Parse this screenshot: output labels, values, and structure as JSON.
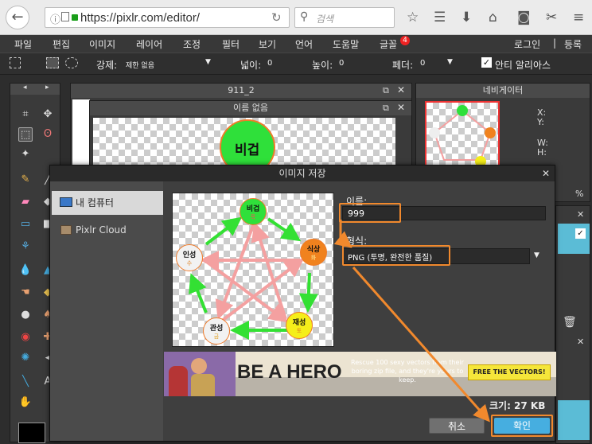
{
  "browser": {
    "url": "https://pixlr.com/editor/",
    "search_placeholder": "검색",
    "icons": [
      "back-icon",
      "info-icon",
      "page-icon",
      "lock-icon",
      "reload-icon",
      "search-icon",
      "star-icon",
      "reading-list-icon",
      "download-icon",
      "home-icon",
      "pocket-icon",
      "screenshot-icon",
      "menu-icon"
    ]
  },
  "menu": {
    "items": [
      "파일",
      "편집",
      "이미지",
      "레이어",
      "조정",
      "필터",
      "보기",
      "언어",
      "도움말",
      "글꼴"
    ],
    "badge": "4",
    "login": "로그인",
    "separator": "|",
    "register": "등록"
  },
  "options": {
    "force_label": "강제:",
    "force_value": "제한 없음",
    "width_label": "넓이:",
    "width_value": "0",
    "height_label": "높이:",
    "height_value": "0",
    "feather_label": "페더:",
    "feather_value": "0",
    "antialias_label": "안티 알리아스"
  },
  "panels": {
    "doc1_title": "911_2",
    "doc2_title": "이름 없음",
    "doc2_canvas_text": "비겁",
    "navigator_title": "네비게이터",
    "nav_x": "X:",
    "nav_y": "Y:",
    "nav_w": "W:",
    "nav_h": "H:",
    "zoom_unit": "%"
  },
  "dialog": {
    "title": "이미지 저장",
    "locations": [
      "내 컴퓨터",
      "Pixlr Cloud"
    ],
    "name_label": "이름:",
    "name_value": "999",
    "format_label": "형식:",
    "format_value": "PNG (투명, 완전한 품질)",
    "size_text": "크기: 27 KB",
    "cancel_label": "취소",
    "ok_label": "확인",
    "ad": {
      "headline": "BE A HERO",
      "body": "Rescue 100 sexy vectors from their boring zip file, and they're yours to keep.",
      "cta": "FREE THE VECTORS!"
    }
  },
  "preview": {
    "nodes": [
      {
        "label": "비겁",
        "sub": "목",
        "color": "#2fe03a"
      },
      {
        "label": "식상",
        "sub": "화",
        "color": "#f0821e"
      },
      {
        "label": "재성",
        "sub": "토",
        "color": "#f5ee1a"
      },
      {
        "label": "관성",
        "sub": "금",
        "color": "#f2f2f2"
      },
      {
        "label": "인성",
        "sub": "수",
        "color": "#f2f2f2"
      }
    ]
  },
  "colors": {
    "accent_orange": "#f1892d",
    "ok_button": "#46aee0",
    "green_arrow": "#33e033",
    "pink_star": "#f4a0a0"
  }
}
